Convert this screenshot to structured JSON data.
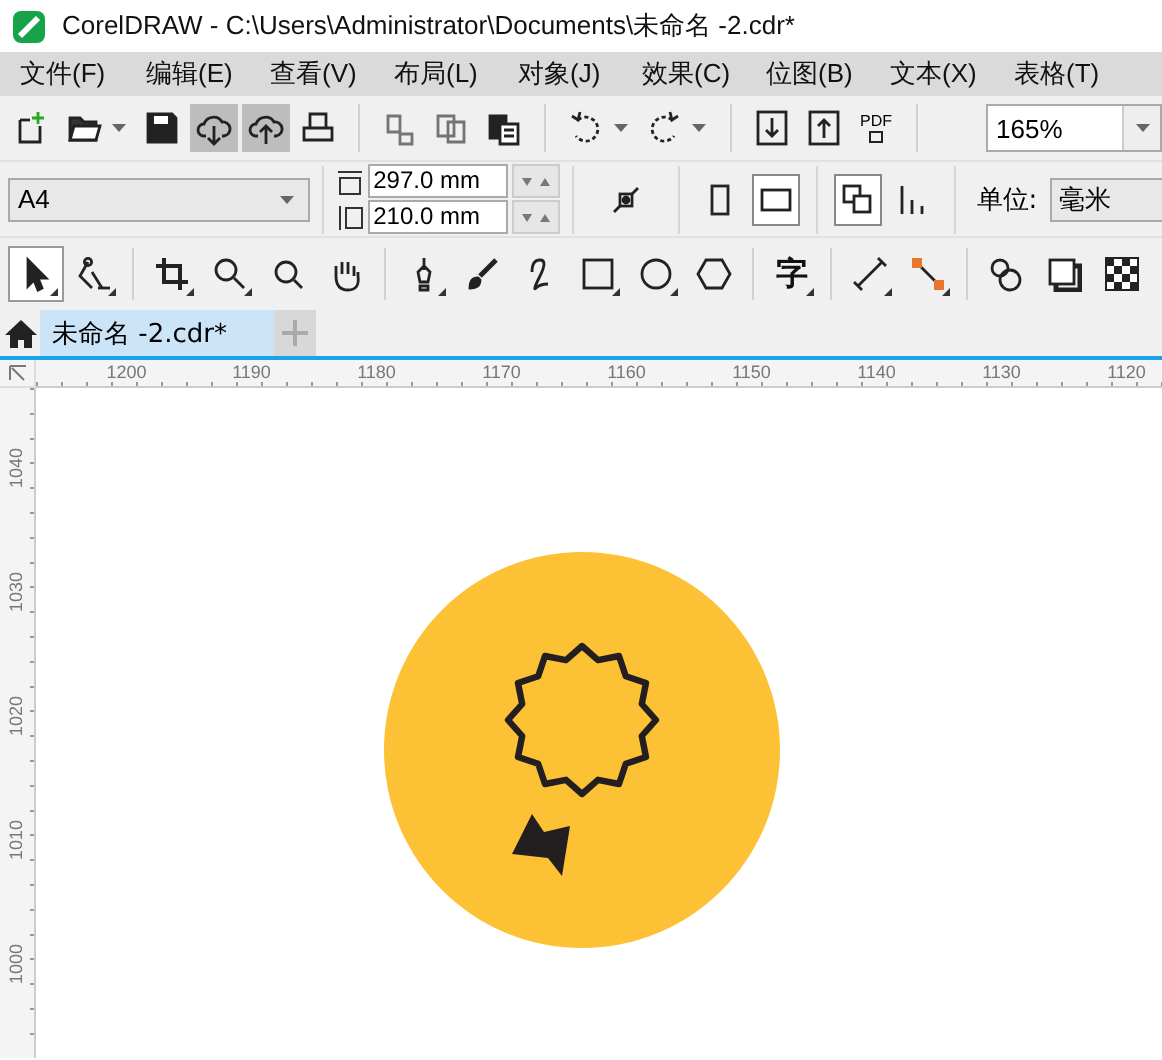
{
  "window": {
    "title": "CorelDRAW - C:\\Users\\Administrator\\Documents\\未命名 -2.cdr*"
  },
  "menu": [
    "文件(F)",
    "编辑(E)",
    "查看(V)",
    "布局(L)",
    "对象(J)",
    "效果(C)",
    "位图(B)",
    "文本(X)",
    "表格(T)"
  ],
  "toolbar": {
    "buttons": [
      {
        "pressed": false,
        "disabled": false
      },
      {
        "pressed": false,
        "disabled": false
      },
      {
        "pressed": false,
        "disabled": false
      },
      {
        "pressed": true,
        "disabled": false
      },
      {
        "pressed": true,
        "disabled": false
      },
      {
        "pressed": false,
        "disabled": false
      },
      {
        "pressed": false,
        "disabled": true
      },
      {
        "pressed": false,
        "disabled": true
      },
      {
        "pressed": false,
        "disabled": false
      },
      {
        "pressed": false,
        "disabled": false
      },
      {
        "pressed": false,
        "disabled": false
      },
      {
        "pressed": false,
        "disabled": false
      },
      {
        "pressed": false,
        "disabled": false
      },
      {
        "pressed": false,
        "disabled": false,
        "label": "PDF"
      }
    ],
    "zoom": "165%"
  },
  "property_bar": {
    "page_size": "A4",
    "width": "297.0 mm",
    "height": "210.0 mm",
    "orientation": [
      {
        "selected": false
      },
      {
        "selected": true
      }
    ],
    "page_layout": [
      {
        "selected": true
      },
      {
        "selected": false
      }
    ],
    "units_label": "单位:",
    "units": "毫米"
  },
  "tools": [
    {
      "selected": true
    },
    {
      "selected": false
    },
    {
      "selected": false
    },
    {
      "selected": false
    },
    {
      "selected": false
    },
    {
      "selected": false
    },
    {
      "selected": false
    },
    {
      "selected": false
    },
    {
      "selected": false
    },
    {
      "selected": false
    },
    {
      "selected": false
    },
    {
      "selected": false
    },
    {
      "selected": false,
      "label": "字"
    },
    {
      "selected": false
    },
    {
      "selected": false
    },
    {
      "selected": false
    },
    {
      "selected": false
    },
    {
      "selected": false
    }
  ],
  "tabs": [
    {
      "label": "未命名 -2.cdr*",
      "selected": true
    }
  ],
  "rulers": {
    "horizontal": [
      "1200",
      "1190",
      "1180",
      "1170",
      "1160",
      "1150",
      "1140",
      "1130",
      "1120"
    ],
    "vertical": [
      "1040",
      "1030",
      "1020",
      "1010",
      "1000"
    ]
  }
}
